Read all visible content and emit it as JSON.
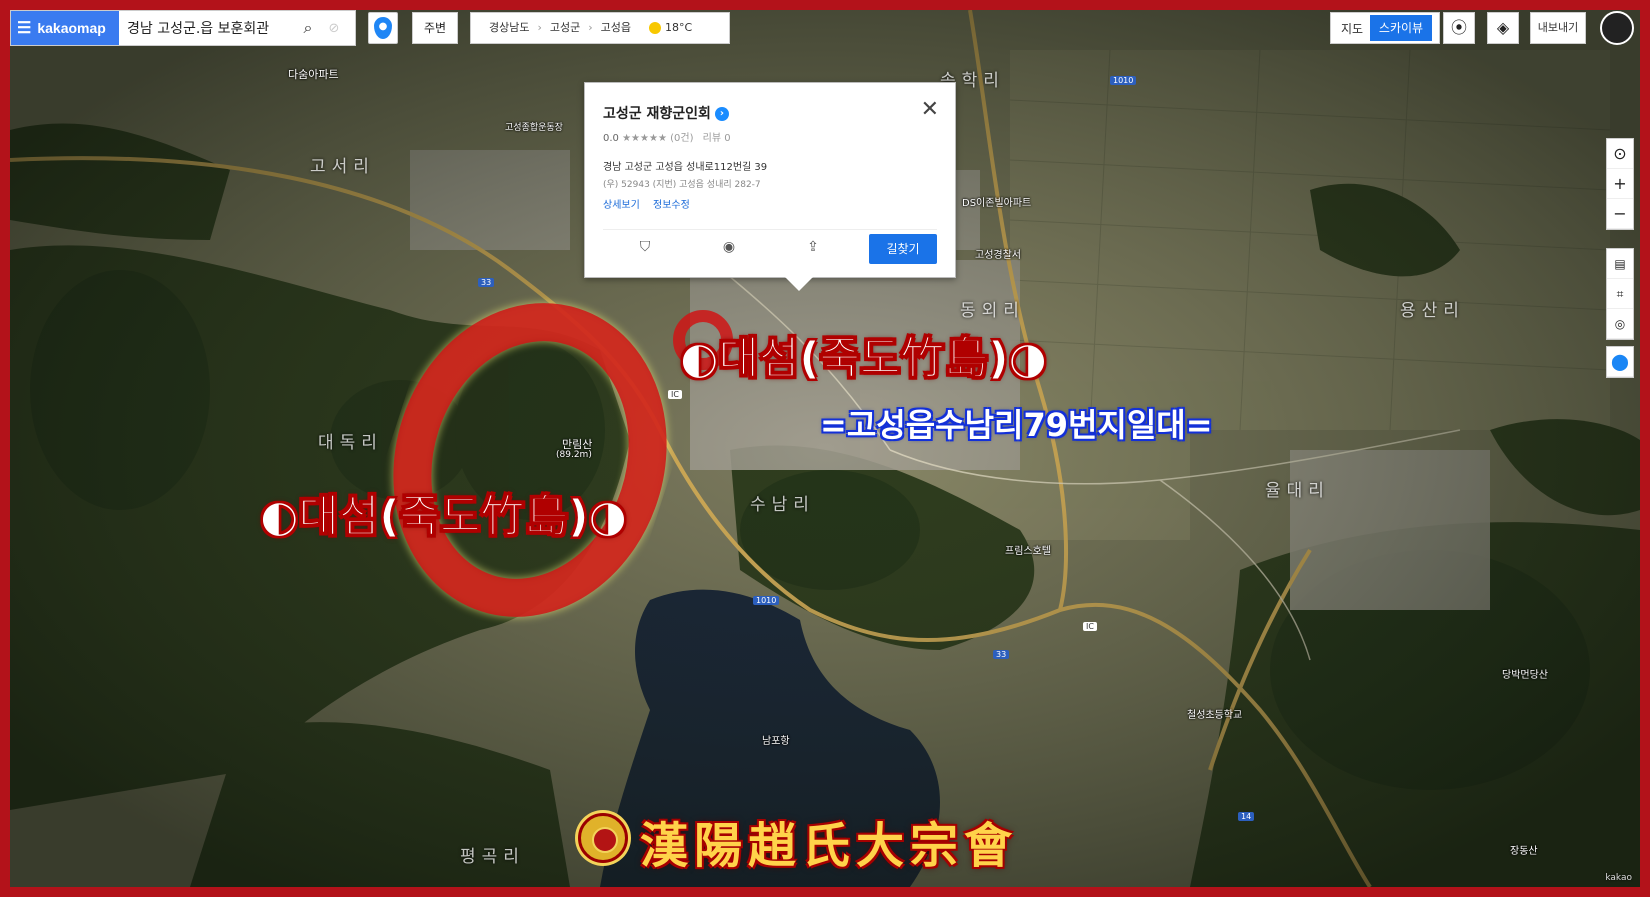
{
  "search": {
    "logo_text": "kakaomap",
    "query": "경남 고성군.읍 보훈회관"
  },
  "nearby_label": "주변",
  "breadcrumb": {
    "province": "경상남도",
    "county": "고성군",
    "town": "고성읍",
    "temperature": "18°C"
  },
  "map_type": {
    "map": "지도",
    "skyview": "스카이뷰"
  },
  "export_label": "내보내기",
  "popup": {
    "name": "고성군 재향군인회",
    "rating": "0.0",
    "review_count": "(0건)",
    "review_label": "리뷰 0",
    "address": "경남 고성군 고성읍 성내로112번길 39",
    "sub_address": "(우) 52943 (지번) 고성읍 성내리 282-7",
    "link_detail": "상세보기",
    "link_edit": "정보수정",
    "route_label": "길찾기"
  },
  "labels": {
    "songhakri": "송학리",
    "gosori": "고서리",
    "daedokri": "대독리",
    "dongoeri": "동외리",
    "yongsanri": "용산리",
    "suri": "수남리",
    "yuldaeri": "율대리",
    "pyeongri": "평곡리",
    "manlimsan": "만림산",
    "manlimsan_h": "(89.2m)",
    "dasum_apt": "다숨아파트",
    "gosung_stadium": "고성종합운동장",
    "gosung_police": "고성경찰서",
    "ds_apt": "DS이존빌아파트",
    "primus": "프림스호텔",
    "nampo": "남포항",
    "dangbang": "당박먼당산",
    "jangdongsan": "장동산",
    "cheolseong_school": "철성초등학교",
    "road_33": "33",
    "road_1010": "1010",
    "road_14": "14",
    "ic": "IC",
    "kakao": "kakao"
  },
  "overlay": {
    "main_title": "◐대섬(죽도竹島)◑",
    "sub_title": "=고성읍수남리79번지일대=",
    "clan_name": "漢陽趙氏大宗會"
  },
  "colors": {
    "accent_blue": "#1a73e8",
    "highlight_red": "#d01010"
  }
}
